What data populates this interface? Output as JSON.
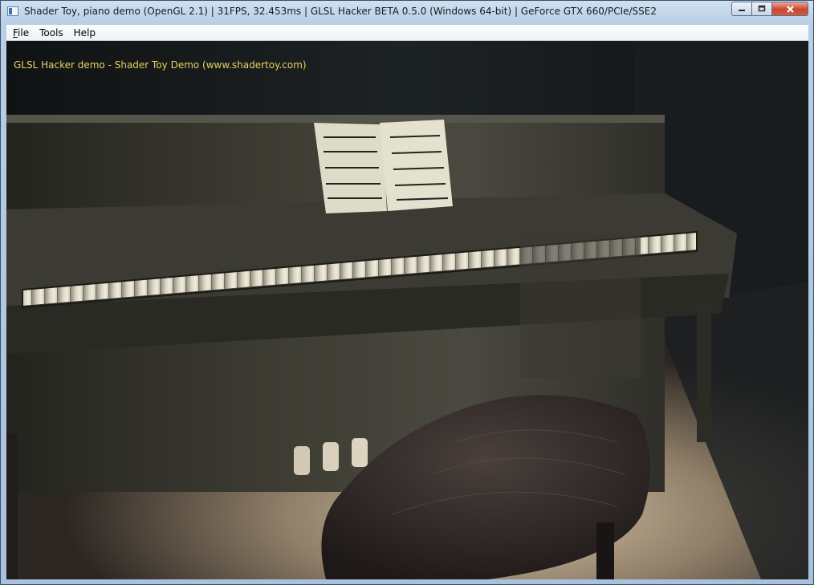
{
  "window": {
    "title": "Shader Toy, piano demo (OpenGL 2.1) | 31FPS, 32.453ms | GLSL Hacker BETA 0.5.0 (Windows 64-bit) | GeForce GTX 660/PCIe/SSE2",
    "icon": "app-icon",
    "controls": {
      "minimize": "minimize-icon",
      "maximize": "maximize-icon",
      "close": "close-icon"
    }
  },
  "menubar": {
    "items": [
      {
        "label": "File",
        "accelerator": "F",
        "rest": "ile"
      },
      {
        "label": "Tools"
      },
      {
        "label": "Help"
      }
    ]
  },
  "viewport": {
    "overlay_text": "GLSL Hacker demo - Shader Toy Demo (www.shadertoy.com)",
    "overlay_color": "#e8d060",
    "scene": "3D rendering of an upright piano with sheet music and a tufted bench in a dark room"
  },
  "colors": {
    "titlebar": "#b9cfe6",
    "close_button": "#c7452f",
    "menubar": "#f3f5f8",
    "scene_background": "#15181a"
  }
}
